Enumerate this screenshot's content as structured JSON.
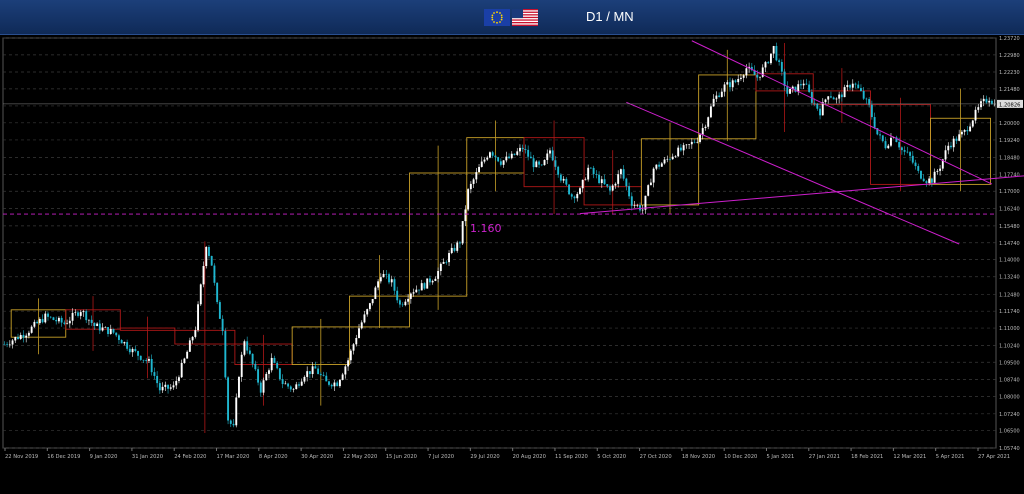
{
  "header": {
    "title": "D1 / MN",
    "flag_left": "eu-flag-icon",
    "flag_right": "us-flag-icon"
  },
  "colors": {
    "candle_up": "#ffffff",
    "candle_down": "#1fb7d0",
    "channel": "#cc1fcc",
    "box_gold": "#c8a028",
    "box_red": "#b01818",
    "grid": "#3a3a3a",
    "price_line": "#cc22cc"
  },
  "chart_data": {
    "type": "candlestick",
    "title": "D1 / MN",
    "grid": true,
    "ylim": [
      1.0574,
      1.2372
    ],
    "y_ticks": [
      1.2372,
      1.2298,
      1.2223,
      1.2149,
      1.2074,
      1.2,
      1.1925,
      1.1848,
      1.1774,
      1.17,
      1.1625,
      1.1548,
      1.1474,
      1.14,
      1.1325,
      1.1248,
      1.1174,
      1.11,
      1.1024,
      1.095,
      1.0874,
      1.08,
      1.0724,
      1.065,
      1.0574
    ],
    "y_labels": [
      "1.23720",
      "1.22980",
      "1.22230",
      "1.21480",
      "1.20740",
      "1.20000",
      "1.19240",
      "1.18480",
      "1.17740",
      "1.17000",
      "1.16240",
      "1.15480",
      "1.14740",
      "1.14000",
      "1.13240",
      "1.12480",
      "1.11740",
      "1.11000",
      "1.10240",
      "1.09500",
      "1.08740",
      "1.08000",
      "1.07240",
      "1.06500",
      "1.05740"
    ],
    "current_price_label": "1.20826",
    "current_price": 1.2083,
    "x_labels": [
      "22 Nov 2019",
      "16 Dec 2019",
      "9 Jan 2020",
      "31 Jan 2020",
      "24 Feb 2020",
      "17 Mar 2020",
      "8 Apr 2020",
      "30 Apr 2020",
      "22 May 2020",
      "15 Jun 2020",
      "7 Jul 2020",
      "29 Jul 2020",
      "20 Aug 2020",
      "11 Sep 2020",
      "5 Oct 2020",
      "27 Oct 2020",
      "18 Nov 2020",
      "10 Dec 2020",
      "5 Jan 2021",
      "27 Jan 2021",
      "18 Feb 2021",
      "12 Mar 2021",
      "5 Apr 2021",
      "27 Apr 2021"
    ],
    "annotation": {
      "text": "1.160",
      "price": 1.16
    },
    "support_line": {
      "price": 1.16
    },
    "channel_upper": [
      {
        "bar": 252,
        "price": 1.236
      },
      {
        "bar": 350,
        "price": 1.18
      }
    ],
    "channel_lower": [
      {
        "bar": 228,
        "price": 1.209
      },
      {
        "bar": 336,
        "price": 1.154
      }
    ],
    "trend_line": [
      {
        "bar": 211,
        "price": 1.1602
      },
      {
        "bar": 396,
        "price": 1.179
      }
    ],
    "monthly_boxes": [
      {
        "start": 3,
        "end": 23,
        "open": 1.106,
        "close": 1.118,
        "high": 1.123,
        "low": 1.0985
      },
      {
        "start": 23,
        "end": 43,
        "open": 1.118,
        "close": 1.1095,
        "high": 1.124,
        "low": 1.1
      },
      {
        "start": 43,
        "end": 63,
        "open": 1.11,
        "close": 1.109,
        "high": 1.115,
        "low": 1.088
      },
      {
        "start": 63,
        "end": 85,
        "open": 1.109,
        "close": 1.103,
        "high": 1.148,
        "low": 1.064
      },
      {
        "start": 85,
        "end": 106,
        "open": 1.103,
        "close": 1.094,
        "high": 1.107,
        "low": 1.076
      },
      {
        "start": 106,
        "end": 127,
        "open": 1.094,
        "close": 1.1105,
        "high": 1.114,
        "low": 1.076
      },
      {
        "start": 127,
        "end": 149,
        "open": 1.1105,
        "close": 1.124,
        "high": 1.142,
        "low": 1.11
      },
      {
        "start": 149,
        "end": 170,
        "open": 1.124,
        "close": 1.178,
        "high": 1.19,
        "low": 1.118
      },
      {
        "start": 170,
        "end": 191,
        "open": 1.178,
        "close": 1.1935,
        "high": 1.201,
        "low": 1.17
      },
      {
        "start": 191,
        "end": 213,
        "open": 1.1935,
        "close": 1.172,
        "high": 1.201,
        "low": 1.16
      },
      {
        "start": 213,
        "end": 234,
        "open": 1.172,
        "close": 1.164,
        "high": 1.188,
        "low": 1.16
      },
      {
        "start": 234,
        "end": 255,
        "open": 1.164,
        "close": 1.193,
        "high": 1.2,
        "low": 1.16
      },
      {
        "start": 255,
        "end": 276,
        "open": 1.193,
        "close": 1.221,
        "high": 1.232,
        "low": 1.192
      },
      {
        "start": 276,
        "end": 297,
        "open": 1.2215,
        "close": 1.214,
        "high": 1.235,
        "low": 1.196
      },
      {
        "start": 297,
        "end": 318,
        "open": 1.214,
        "close": 1.208,
        "high": 1.224,
        "low": 1.2
      },
      {
        "start": 318,
        "end": 340,
        "open": 1.208,
        "close": 1.173,
        "high": 1.211,
        "low": 1.17
      },
      {
        "start": 340,
        "end": 362,
        "open": 1.173,
        "close": 1.202,
        "high": 1.215,
        "low": 1.17
      }
    ],
    "waypoints": [
      [
        0,
        1.103
      ],
      [
        8,
        1.108
      ],
      [
        15,
        1.115
      ],
      [
        22,
        1.112
      ],
      [
        28,
        1.118
      ],
      [
        33,
        1.111
      ],
      [
        40,
        1.108
      ],
      [
        47,
        1.1
      ],
      [
        53,
        1.095
      ],
      [
        57,
        1.083
      ],
      [
        62,
        1.084
      ],
      [
        66,
        1.096
      ],
      [
        70,
        1.11
      ],
      [
        72,
        1.128
      ],
      [
        74,
        1.147
      ],
      [
        76,
        1.138
      ],
      [
        78,
        1.12
      ],
      [
        80,
        1.11
      ],
      [
        82,
        1.07
      ],
      [
        84,
        1.066
      ],
      [
        86,
        1.09
      ],
      [
        88,
        1.105
      ],
      [
        91,
        1.094
      ],
      [
        94,
        1.083
      ],
      [
        98,
        1.096
      ],
      [
        102,
        1.086
      ],
      [
        106,
        1.083
      ],
      [
        110,
        1.09
      ],
      [
        114,
        1.092
      ],
      [
        118,
        1.086
      ],
      [
        122,
        1.086
      ],
      [
        126,
        1.096
      ],
      [
        130,
        1.11
      ],
      [
        134,
        1.12
      ],
      [
        138,
        1.134
      ],
      [
        142,
        1.13
      ],
      [
        145,
        1.12
      ],
      [
        149,
        1.126
      ],
      [
        154,
        1.129
      ],
      [
        158,
        1.133
      ],
      [
        163,
        1.142
      ],
      [
        167,
        1.148
      ],
      [
        170,
        1.17
      ],
      [
        174,
        1.18
      ],
      [
        178,
        1.188
      ],
      [
        182,
        1.183
      ],
      [
        186,
        1.185
      ],
      [
        190,
        1.189
      ],
      [
        194,
        1.182
      ],
      [
        197,
        1.18
      ],
      [
        200,
        1.188
      ],
      [
        204,
        1.176
      ],
      [
        208,
        1.168
      ],
      [
        211,
        1.17
      ],
      [
        214,
        1.18
      ],
      [
        218,
        1.175
      ],
      [
        222,
        1.17
      ],
      [
        226,
        1.179
      ],
      [
        230,
        1.165
      ],
      [
        234,
        1.162
      ],
      [
        238,
        1.18
      ],
      [
        242,
        1.183
      ],
      [
        246,
        1.187
      ],
      [
        250,
        1.189
      ],
      [
        254,
        1.193
      ],
      [
        257,
        1.2
      ],
      [
        260,
        1.21
      ],
      [
        264,
        1.216
      ],
      [
        268,
        1.218
      ],
      [
        272,
        1.224
      ],
      [
        276,
        1.22
      ],
      [
        279,
        1.225
      ],
      [
        282,
        1.233
      ],
      [
        284,
        1.225
      ],
      [
        287,
        1.213
      ],
      [
        290,
        1.215
      ],
      [
        293,
        1.218
      ],
      [
        296,
        1.21
      ],
      [
        299,
        1.205
      ],
      [
        302,
        1.213
      ],
      [
        305,
        1.21
      ],
      [
        308,
        1.214
      ],
      [
        311,
        1.218
      ],
      [
        314,
        1.213
      ],
      [
        317,
        1.207
      ],
      [
        320,
        1.195
      ],
      [
        323,
        1.19
      ],
      [
        326,
        1.195
      ],
      [
        329,
        1.188
      ],
      [
        332,
        1.185
      ],
      [
        335,
        1.178
      ],
      [
        338,
        1.175
      ],
      [
        340,
        1.175
      ],
      [
        343,
        1.181
      ],
      [
        346,
        1.19
      ],
      [
        349,
        1.193
      ],
      [
        352,
        1.196
      ],
      [
        355,
        1.202
      ],
      [
        358,
        1.208
      ],
      [
        361,
        1.211
      ],
      [
        363,
        1.208
      ]
    ],
    "total_bars": 364
  }
}
